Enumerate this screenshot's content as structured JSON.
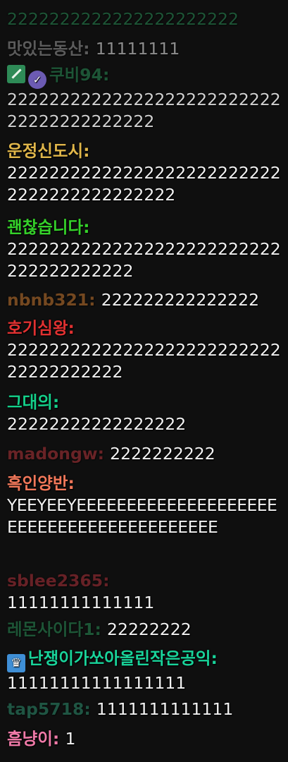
{
  "colors": {
    "background": "#0f0f0f",
    "message_text": "#f2f2f2"
  },
  "messages": [
    {
      "username": "",
      "text": "2222222222222222222222",
      "name_color": "#2a8f57",
      "faded": true
    },
    {
      "username": "맛있는동산",
      "text": "11111111",
      "name_color": "#9a9a9a",
      "faded": true
    },
    {
      "username": "쿠비94",
      "text": "2222222222222222222222222222222222222222",
      "name_color": "#2a8f57",
      "faded": true,
      "badges": [
        "sword-icon",
        "verified-check-icon"
      ]
    },
    {
      "username": "운정신도시",
      "text": "222222222222222222222222222222222222222222",
      "name_color": "#e0b64a"
    },
    {
      "username": "괜찮습니다",
      "text": "22222222222222222222222222222222222222",
      "name_color": "#35d12a"
    },
    {
      "username": "nbnb321",
      "text": "222222222222222",
      "name_color": "#c7782f",
      "faded": true
    },
    {
      "username": "호기심왕",
      "text": "2222222222222222222222222222222222222",
      "name_color": "#e03131"
    },
    {
      "username": "그대의",
      "text": "22222222222222222",
      "name_color": "#14d08a"
    },
    {
      "username": "madongw",
      "text": "2222222222",
      "name_color": "#b3343a",
      "faded": true
    },
    {
      "username": "흑인양반",
      "text": "YEEYEEYEEEEEEEEEEEEEEEEEEEEEEEEEEEEEEEEEEEEEEEEE",
      "name_color": "#f2785a"
    },
    {
      "username": "sblee2365",
      "text": "11111111111111",
      "name_color": "#b0303a",
      "faded": true
    },
    {
      "username": "레몬사이다1",
      "text": "22222222",
      "name_color": "#2a8f57",
      "faded": true
    },
    {
      "username": "난쟁이가쏘아올린작은공익",
      "text": "11111111111111111",
      "name_color": "#19d39a",
      "badges": [
        "crown-icon"
      ]
    },
    {
      "username": "tap5718",
      "text": "1111111111111",
      "name_color": "#2d8f6e",
      "faded": true
    },
    {
      "username": "흠냥이",
      "text": "1",
      "name_color": "#f07aa8"
    }
  ]
}
